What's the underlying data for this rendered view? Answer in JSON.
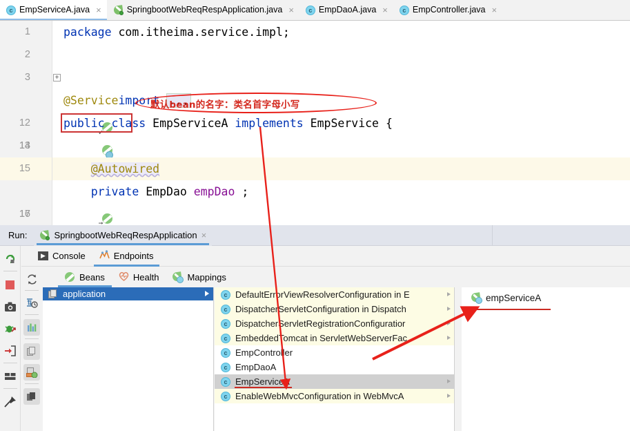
{
  "editor_tabs": [
    {
      "label": "EmpServiceA.java",
      "icon": "class-icon",
      "active": true,
      "close": "×"
    },
    {
      "label": "SpringbootWebReqRespApplication.java",
      "icon": "spring-boot-icon",
      "active": false,
      "close": "×"
    },
    {
      "label": "EmpDaoA.java",
      "icon": "class-icon",
      "active": false,
      "close": "×"
    },
    {
      "label": "EmpController.java",
      "icon": "class-icon",
      "active": false,
      "close": "×"
    }
  ],
  "code": {
    "lines": [
      {
        "num": "1",
        "gutter": "",
        "highlight": false
      },
      {
        "num": "2",
        "gutter": "",
        "highlight": false
      },
      {
        "num": "3",
        "gutter": "",
        "highlight": false
      },
      {
        "num": "12",
        "gutter": "bean-check-icon",
        "highlight": false
      },
      {
        "num": "13",
        "gutter": "bean-impl-icon",
        "highlight": false
      },
      {
        "num": "14",
        "gutter": "",
        "highlight": false
      },
      {
        "num": "15",
        "gutter": "",
        "highlight": true
      },
      {
        "num": "16",
        "gutter": "bean-autowired-icon",
        "highlight": false
      },
      {
        "num": "17",
        "gutter": "",
        "highlight": false
      }
    ],
    "l1_kw": "package",
    "l1_rest": " com.itheima.service.impl;",
    "l3_kw": "import",
    "l3_fold": "+",
    "l3_dots": "...",
    "l12_annotation": "@Service",
    "l13_kw1": "public",
    "l13_kw2": "class",
    "l13_name": "EmpServiceA",
    "l13_kw3": "implements",
    "l13_iface": "EmpService",
    "l13_brace": "{",
    "l15_annotation": "@Autowired",
    "l16_kw": "private",
    "l16_type": "EmpDao",
    "l16_field": "empDao",
    "l16_semi": ";"
  },
  "annotation": {
    "text": "默认bean的名字：类名首字母小写",
    "color": "#d42a20",
    "box_color": "#cc3333",
    "ellipse_color": "#e8211a"
  },
  "run_panel": {
    "label": "Run:",
    "config_tab": "SpringbootWebReqRespApplication",
    "config_tab_icon": "spring-boot-icon",
    "config_tab_close": "×",
    "left_toolbar": [
      {
        "name": "rerun-icon"
      },
      {
        "name": "stop-icon"
      },
      {
        "name": "screenshot-icon"
      },
      {
        "name": "debug-attach-icon"
      },
      {
        "name": "export-icon"
      },
      {
        "name": "layout-icon"
      },
      {
        "name": "pin-icon"
      }
    ],
    "sub_toolbar": [
      {
        "name": "refresh-icon"
      },
      {
        "name": "live-reload-icon"
      },
      {
        "name": "bar-chart-icon",
        "boxed": true
      },
      {
        "name": "copy-beans-icon",
        "boxed": true
      },
      {
        "name": "diagram-icon",
        "boxed": true
      },
      {
        "name": "layers-icon",
        "boxed": true
      }
    ],
    "tabs": [
      {
        "label": "Console",
        "icon": "console-icon",
        "active": false
      },
      {
        "label": "Endpoints",
        "icon": "endpoints-icon",
        "active": true
      }
    ],
    "subtabs": [
      {
        "label": "Beans",
        "icon": "beans-icon",
        "active": true
      },
      {
        "label": "Health",
        "icon": "health-icon",
        "active": false
      },
      {
        "label": "Mappings",
        "icon": "mappings-icon",
        "active": false
      }
    ],
    "tree_root": {
      "label": "application",
      "icon": "module-icon",
      "selected": true
    },
    "beans": [
      {
        "label": "DefaultErrorViewResolverConfiguration in E",
        "stripe": "odd",
        "selected": false,
        "expandable": true
      },
      {
        "label": "DispatcherServletConfiguration in Dispatch",
        "stripe": "odd",
        "selected": false,
        "expandable": true
      },
      {
        "label": "DispatcherServletRegistrationConfiguratior",
        "stripe": "odd",
        "selected": false,
        "expandable": true
      },
      {
        "label": "EmbeddedTomcat in ServletWebServerFac",
        "stripe": "odd",
        "selected": false,
        "expandable": true
      },
      {
        "label": "EmpController",
        "stripe": "even",
        "selected": false,
        "expandable": false
      },
      {
        "label": "EmpDaoA",
        "stripe": "even",
        "selected": false,
        "expandable": false
      },
      {
        "label": "EmpServiceA",
        "stripe": "sel",
        "selected": true,
        "expandable": true
      },
      {
        "label": "EnableWebMvcConfiguration in WebMvcA",
        "stripe": "odd",
        "selected": false,
        "expandable": true
      }
    ],
    "detail": {
      "label": "empServiceA",
      "icon": "spring-bean-icon"
    }
  }
}
